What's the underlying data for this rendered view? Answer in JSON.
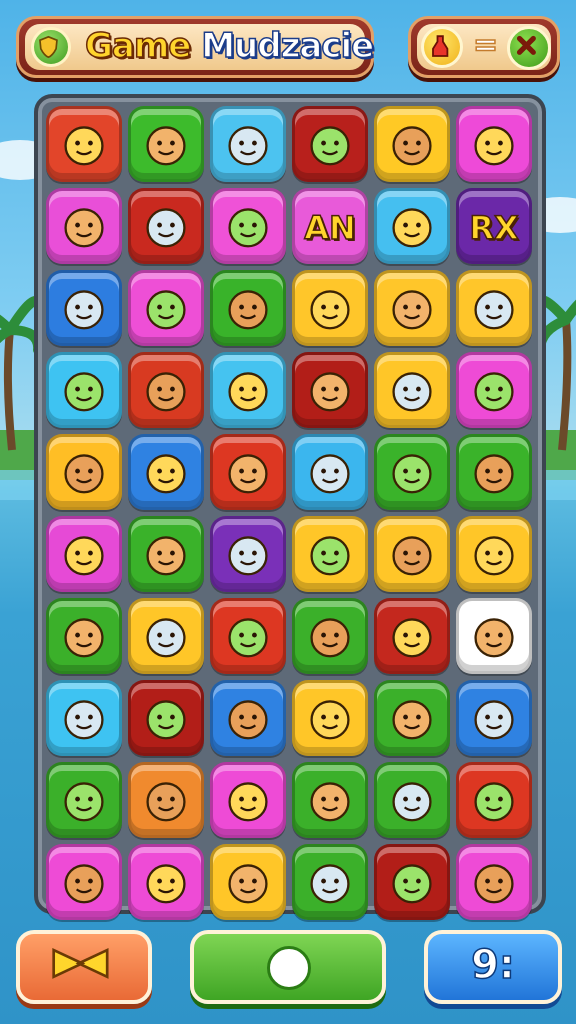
{
  "header": {
    "title_part1": "Game",
    "title_part2": "Mudzacie",
    "title_icon": "shield-emblem-icon",
    "score_icon": "potion-bottle-icon",
    "score_separator": "=",
    "close_icon": "close-icon"
  },
  "board": {
    "rows": 10,
    "cols": 6,
    "tiles": [
      [
        {
          "color": "#e2452a",
          "icon": "yellow-cat-icon"
        },
        {
          "color": "#3dbb2c",
          "icon": "king-face-icon"
        },
        {
          "color": "#4cc3f0",
          "icon": "crowned-face-icon"
        },
        {
          "color": "#b8201c",
          "icon": "unicorn-face-icon"
        },
        {
          "color": "#ffc925",
          "icon": "drink-cup-icon"
        },
        {
          "color": "#ee4ad8",
          "icon": "crowned-face-icon"
        }
      ],
      [
        {
          "color": "#e94fd8",
          "icon": "crowned-bear-icon"
        },
        {
          "color": "#c9291f",
          "icon": "green-dragon-icon"
        },
        {
          "color": "#ef52d7",
          "icon": "bear-face-icon"
        },
        {
          "color": "#e85ad9",
          "icon": "text-tile",
          "text": "AN"
        },
        {
          "color": "#45bff0",
          "icon": "king-face-icon"
        },
        {
          "color": "#6b28a8",
          "icon": "text-tile",
          "text": "RX"
        }
      ],
      [
        {
          "color": "#2d7de0",
          "icon": "sun-icon"
        },
        {
          "color": "#ee4fd6",
          "icon": "fish-icon"
        },
        {
          "color": "#39b32a",
          "icon": "house-icon"
        },
        {
          "color": "#ffc62a",
          "icon": "axe-icon"
        },
        {
          "color": "#ffc62a",
          "icon": "wizard-portrait-icon"
        },
        {
          "color": "#ffc62a",
          "icon": "tools-icon"
        }
      ],
      [
        {
          "color": "#3ec3f2",
          "icon": "crossed-swords-icon"
        },
        {
          "color": "#d83a21",
          "icon": "books-icon"
        },
        {
          "color": "#45c3f0",
          "icon": "crossed-swords-icon"
        },
        {
          "color": "#b21e18",
          "icon": "knight-helmet-icon"
        },
        {
          "color": "#ffc628",
          "icon": "potion-tube-icon"
        },
        {
          "color": "#ee4bd6",
          "icon": "star-icon"
        }
      ],
      [
        {
          "color": "#ffbe25",
          "icon": "pirate-face-icon"
        },
        {
          "color": "#2f82e2",
          "icon": "polar-bear-icon"
        },
        {
          "color": "#dd3722",
          "icon": "clown-face-icon"
        },
        {
          "color": "#3bb6ee",
          "icon": "crowned-face-icon"
        },
        {
          "color": "#3ab32a",
          "icon": "bomb-creature-icon"
        },
        {
          "color": "#3ab32a",
          "icon": "egg-face-icon"
        }
      ],
      [
        {
          "color": "#e64ad6",
          "icon": "robot-face-icon"
        },
        {
          "color": "#3ab22a",
          "icon": "ogre-face-icon"
        },
        {
          "color": "#7a30b8",
          "icon": "bear-face-icon"
        },
        {
          "color": "#ffc628",
          "icon": "globe-icon"
        },
        {
          "color": "#ffc628",
          "icon": "compass-icon"
        },
        {
          "color": "#ffc628",
          "icon": "cactus-face-icon"
        }
      ],
      [
        {
          "color": "#3bb02a",
          "icon": "hammer-icon"
        },
        {
          "color": "#ffc628",
          "icon": "blue-bear-icon"
        },
        {
          "color": "#dd3722",
          "icon": "bear-face-icon"
        },
        {
          "color": "#3bb02a",
          "icon": "black-bear-icon"
        },
        {
          "color": "#c4281e",
          "icon": "king-face-icon"
        },
        {
          "color": "#ffffff",
          "icon": "brown-bear-icon"
        }
      ],
      [
        {
          "color": "#3ec3f2",
          "icon": "crossed-swords-icon"
        },
        {
          "color": "#b21e18",
          "icon": "sun-face-icon"
        },
        {
          "color": "#2f82e2",
          "icon": "black-bear-icon"
        },
        {
          "color": "#ffc628",
          "icon": "polar-bear-icon"
        },
        {
          "color": "#3bb02a",
          "icon": "sun-face-icon"
        },
        {
          "color": "#2f82e2",
          "icon": "treasure-box-icon"
        }
      ],
      [
        {
          "color": "#3bb02a",
          "icon": "egg-face-icon"
        },
        {
          "color": "#f08a2e",
          "icon": "lollipop-face-icon"
        },
        {
          "color": "#ee4bd6",
          "icon": "house-icon"
        },
        {
          "color": "#3bb02a",
          "icon": "card-icon"
        },
        {
          "color": "#3bb02a",
          "icon": "dragon-head-icon"
        },
        {
          "color": "#dd3722",
          "icon": "blue-cat-icon"
        }
      ],
      [
        {
          "color": "#ee4bd6",
          "icon": "egg-face-icon"
        },
        {
          "color": "#ee4bd6",
          "icon": "brushes-icon"
        },
        {
          "color": "#ffc628",
          "icon": "clown-face-icon"
        },
        {
          "color": "#3bb02a",
          "icon": "triangle-puzzle-icon"
        },
        {
          "color": "#b21e18",
          "icon": "goat-face-icon"
        },
        {
          "color": "#ee4bd6",
          "icon": "brown-bear-icon"
        }
      ]
    ]
  },
  "footer": {
    "left_icon": "bowtie-icon",
    "middle_icon": "white-circle-icon",
    "right_label": "9:"
  }
}
